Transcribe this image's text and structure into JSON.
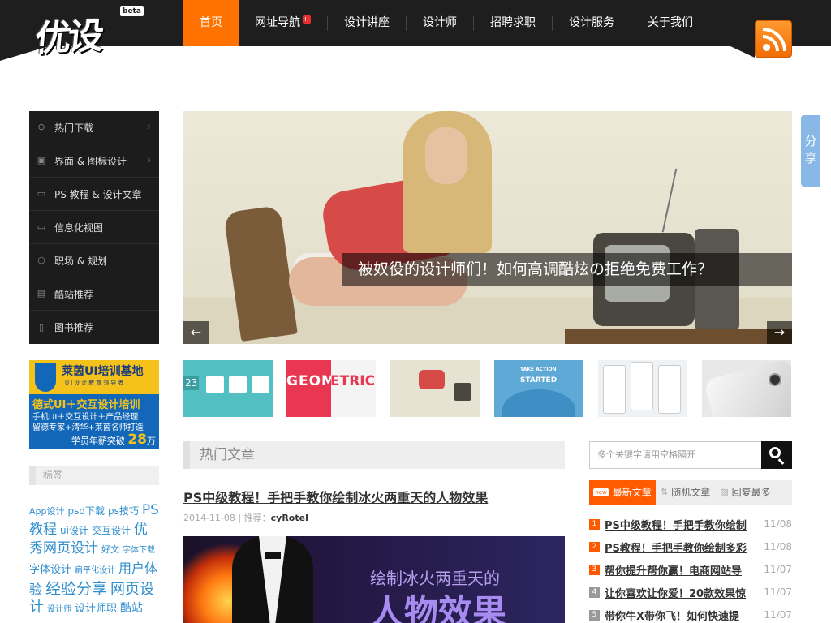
{
  "header": {
    "logo_text": "优设",
    "logo_badge": "beta",
    "nav": [
      {
        "label": "首页",
        "active": true
      },
      {
        "label": "网址导航",
        "badge": "H"
      },
      {
        "label": "设计讲座"
      },
      {
        "label": "设计师"
      },
      {
        "label": "招聘求职"
      },
      {
        "label": "设计服务"
      },
      {
        "label": "关于我们"
      }
    ],
    "rss_icon": "rss-icon"
  },
  "sidebar": {
    "menu": [
      {
        "label": "热门下载",
        "icon": "download-icon",
        "chevron": true
      },
      {
        "label": "界面 & 图标设计",
        "icon": "interface-icon",
        "chevron": true
      },
      {
        "label": "PS 教程 & 设计文章",
        "icon": "ps-icon",
        "chevron": false
      },
      {
        "label": "信息化视图",
        "icon": "monitor-icon",
        "chevron": false
      },
      {
        "label": "职场 & 规划",
        "icon": "chat-bubble-icon",
        "chevron": false
      },
      {
        "label": "酷站推荐",
        "icon": "bookmark-icon",
        "chevron": false
      },
      {
        "label": "图书推荐",
        "icon": "book-icon",
        "chevron": false
      }
    ],
    "ad": {
      "title": "莱茵UI培训基地",
      "subtitle": "UI设计教育领导者",
      "line1": "德式UI＋交互设计培训",
      "line2": "手机UI＋交互设计＋产品经理",
      "line3": "留德专家+清华+莱茵名师打造",
      "footer_prefix": "学员年薪突破",
      "footer_value": "28",
      "footer_unit": "万"
    },
    "tags_heading": "标签",
    "tags": [
      {
        "text": "App设计",
        "size": 11
      },
      {
        "text": "psd下载",
        "size": 12
      },
      {
        "text": "ps技巧",
        "size": 12
      },
      {
        "text": "PS教程",
        "size": 17
      },
      {
        "text": "ui设计",
        "size": 12
      },
      {
        "text": "交互设计",
        "size": 12
      },
      {
        "text": "优秀网页设计",
        "size": 17
      },
      {
        "text": "好文",
        "size": 11
      },
      {
        "text": "字体下载",
        "size": 10
      },
      {
        "text": "字体设计",
        "size": 13
      },
      {
        "text": "扁平化设计",
        "size": 10
      },
      {
        "text": "用户体验",
        "size": 16
      },
      {
        "text": "经验分享",
        "size": 19
      },
      {
        "text": "网页设计",
        "size": 18
      },
      {
        "text": "设计师",
        "size": 10
      },
      {
        "text": "设计师职",
        "size": 13
      },
      {
        "text": "酷站",
        "size": 14
      }
    ]
  },
  "hero": {
    "caption": "被奴役的设计师们！如何高调酷炫の拒绝免费工作？",
    "prev": "←",
    "next": "→"
  },
  "share_tab": {
    "label": "分享"
  },
  "thumbnails": [
    {
      "name": "thumb-icons",
      "text": "23"
    },
    {
      "name": "thumb-geometric",
      "text": "GEOMETRIC",
      "text_a": "GEOM",
      "text_b": "ETRIC"
    },
    {
      "name": "thumb-hero-photo",
      "text": ""
    },
    {
      "name": "thumb-take-action",
      "text_a": "TAKE ACTION",
      "text_b": "STARTED"
    },
    {
      "name": "thumb-mobile-ui",
      "text": ""
    },
    {
      "name": "thumb-device",
      "text": ""
    }
  ],
  "main": {
    "section_title": "热门文章",
    "post": {
      "title": "PS中级教程！手把手教你绘制冰火两重天的人物效果",
      "date": "2014-11-08",
      "meta_sep": " | 推荐：",
      "author": "cyRotel",
      "image_line1": "绘制冰火两重天的",
      "image_line2": "人物效果"
    }
  },
  "right": {
    "search_placeholder": "多个关键字请用空格隔开",
    "tabs": [
      {
        "label": "最新文章",
        "badge": "new",
        "active": true
      },
      {
        "label": "随机文章",
        "icon": "shuffle-icon"
      },
      {
        "label": "回复最多",
        "icon": "comments-icon"
      }
    ],
    "list": [
      {
        "num": "1",
        "title": "PS中级教程！手把手教你绘制",
        "date": "11/08",
        "highlight": true
      },
      {
        "num": "2",
        "title": "PS教程！手把手教你绘制多彩",
        "date": "11/08",
        "highlight": true
      },
      {
        "num": "3",
        "title": "帮你提升帮你赢！电商网站导",
        "date": "11/07",
        "highlight": true
      },
      {
        "num": "4",
        "title": "让你喜欢让你爱！20款效果惊",
        "date": "11/07",
        "highlight": false
      },
      {
        "num": "5",
        "title": "带你牛X带你飞！如何快速提",
        "date": "11/07",
        "highlight": false
      }
    ]
  },
  "colors": {
    "accent": "#ff7200",
    "header_bg": "#1e1e1e",
    "tab_active": "#ff5a00",
    "tag_blue": "#2f8fce"
  }
}
